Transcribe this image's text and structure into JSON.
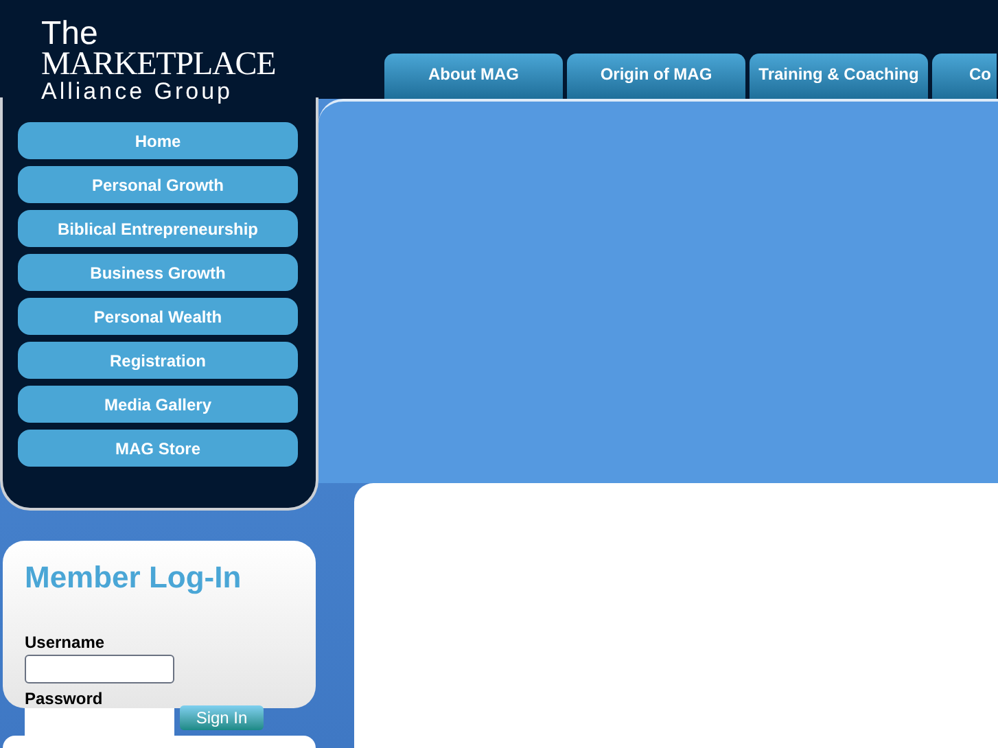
{
  "logo": {
    "line_1": "The",
    "line_2": "MARKETPLACE",
    "line_3": "Alliance Group"
  },
  "tabs": [
    {
      "label": "About MAG"
    },
    {
      "label": "Origin of MAG"
    },
    {
      "label": "Training & Coaching"
    },
    {
      "label": "Co"
    }
  ],
  "sidebar": {
    "items": [
      "Home",
      "Personal Growth",
      "Biblical Entrepreneurship",
      "Business Growth",
      "Personal Wealth",
      "Registration",
      "Media Gallery",
      "MAG Store"
    ]
  },
  "login": {
    "title": "Member Log-In",
    "username_label": "Username",
    "password_label": "Password",
    "button": "Sign In"
  }
}
